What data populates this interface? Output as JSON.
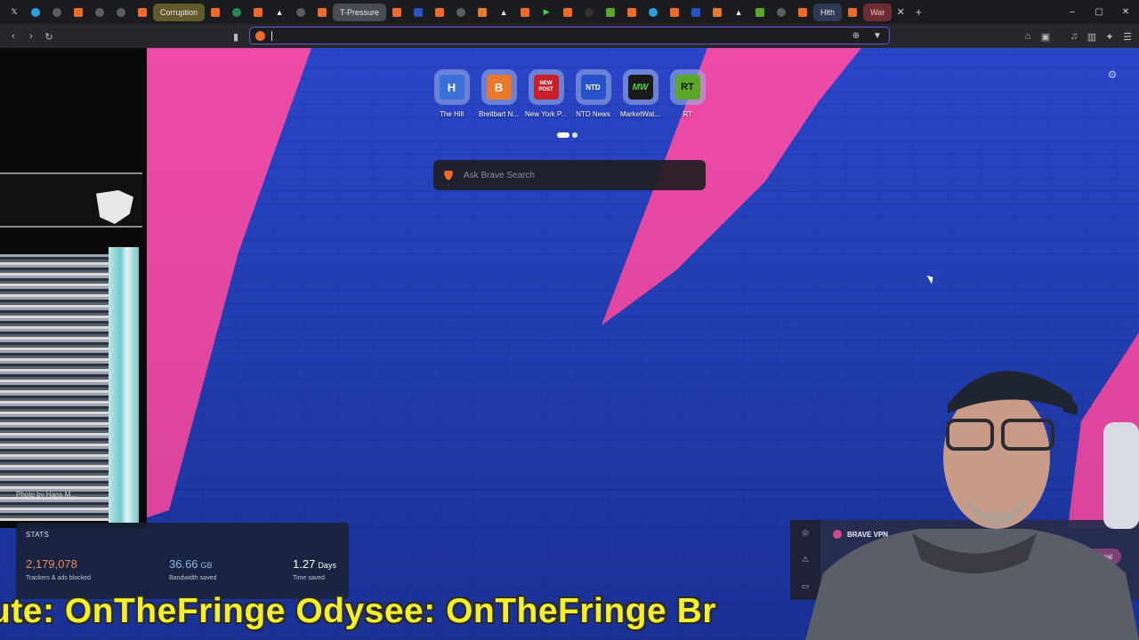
{
  "tabs": {
    "pinned": [
      {
        "icon": "x-icon"
      },
      {
        "icon": "telegram-icon"
      },
      {
        "icon": "globe-icon"
      },
      {
        "icon": "brave-icon"
      },
      {
        "icon": "globe-icon"
      },
      {
        "icon": "globe-icon"
      },
      {
        "icon": "brave-icon"
      }
    ],
    "group_corruption": "Corruption",
    "group_tpressure": "T-Pressure",
    "group_hlth": "Hlth",
    "group_war": "War",
    "close_glyph": "✕",
    "new_tab_glyph": "+"
  },
  "window": {
    "minimize": "–",
    "restore": "▢",
    "close": "✕"
  },
  "toolbar": {
    "back": "‹",
    "forward": "›",
    "reload": "↻",
    "bookmark": "▮",
    "address_value": "",
    "zoom_glyph": "⊕",
    "brave_glyph": "▼",
    "right_icons": [
      "⌂",
      "▣",
      "♫",
      "▥",
      "✦",
      "☰"
    ]
  },
  "top_sites": [
    {
      "name": "The Hill",
      "logo": "H",
      "color": "#3b6fd8"
    },
    {
      "name": "Breitbart N...",
      "logo": "B",
      "color": "#e8782a"
    },
    {
      "name": "New York P...",
      "logo": "NEW POST",
      "color": "#c8202a"
    },
    {
      "name": "NTD News",
      "logo": "NTD",
      "color": "#2a52c8"
    },
    {
      "name": "MarketWat...",
      "logo": "MW",
      "color": "#1a1a1a"
    },
    {
      "name": "RT",
      "logo": "RT",
      "color": "#5aa82a"
    }
  ],
  "search": {
    "placeholder": "Ask Brave Search"
  },
  "settings_glyph": "⚙",
  "photo_credit": "Photo by Hans M...",
  "stats": {
    "title": "STATS",
    "trackers_value": "2,179,078",
    "trackers_label": "Trackers & ads blocked",
    "bandwidth_value": "36.66",
    "bandwidth_unit": "GB",
    "bandwidth_label": "Bandwidth saved",
    "time_value": "1.27",
    "time_unit": "Days",
    "time_label": "Time saved",
    "colors": {
      "trackers": "#f08a5a",
      "bandwidth": "#8fb4f0",
      "time": "#ffffff"
    }
  },
  "vpn": {
    "title": "BRAVE VPN",
    "trial_label": "...e trial",
    "side_icons": [
      "◎",
      "⚠",
      "▭"
    ]
  },
  "ticker": {
    "text": "ute: OnTheFringe Odysee: OnTheFringe Br"
  }
}
